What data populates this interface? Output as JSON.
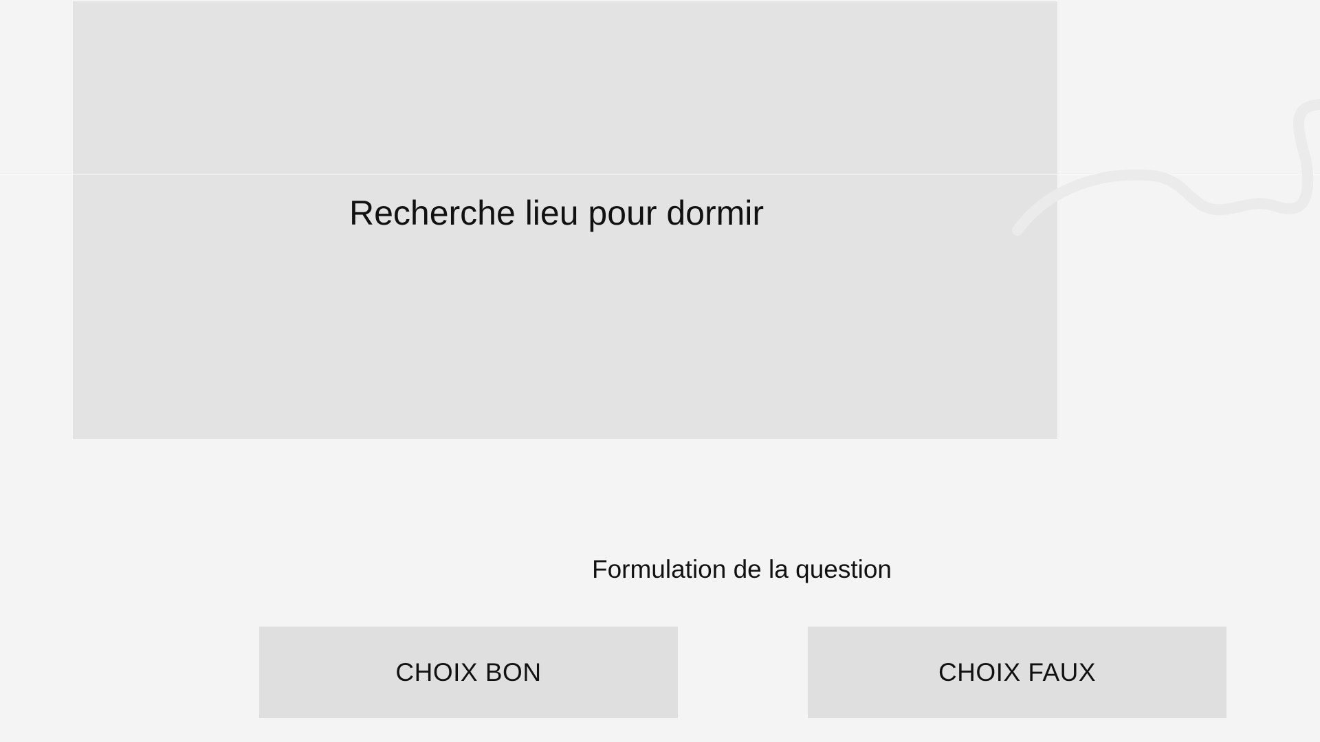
{
  "scene": {
    "title": "Recherche lieu pour dormir"
  },
  "question": {
    "text": "Formulation de la question"
  },
  "choices": [
    {
      "label": "CHOIX BON"
    },
    {
      "label": "CHOIX FAUX"
    }
  ],
  "colors": {
    "background": "#f4f4f4",
    "panel": "#e3e3e3",
    "button": "#dfdfdf",
    "text": "#111111",
    "decoration": "#ebebeb"
  }
}
